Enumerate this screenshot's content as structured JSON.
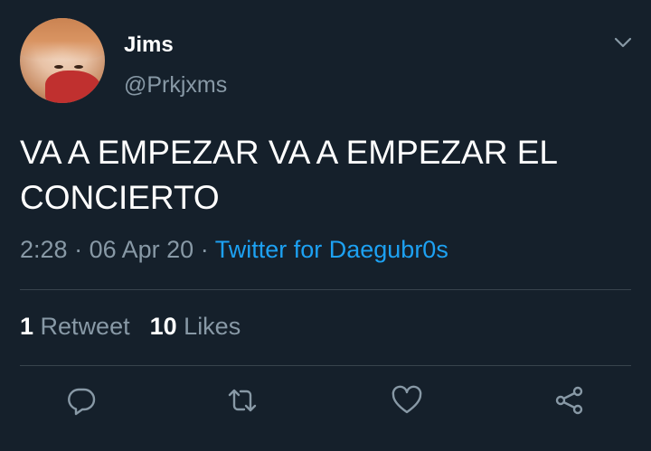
{
  "user": {
    "name": "Jims",
    "handle": "@Prkjxms"
  },
  "tweet": {
    "text": "VA A EMPEZAR VA A EMPEZAR EL CONCIERTO",
    "time": "2:28",
    "date": "06 Apr 20",
    "separator": "·",
    "source": "Twitter for Daegubr0s"
  },
  "stats": {
    "retweets_count": "1",
    "retweets_label": "Retweet",
    "likes_count": "10",
    "likes_label": "Likes"
  },
  "icons": {
    "menu": "chevron-down-icon",
    "reply": "reply-icon",
    "retweet": "retweet-icon",
    "like": "heart-icon",
    "share": "share-icon"
  },
  "colors": {
    "background": "#15202b",
    "accent": "#1da1f2",
    "secondary_text": "#8899a6",
    "divider": "#38444d"
  }
}
